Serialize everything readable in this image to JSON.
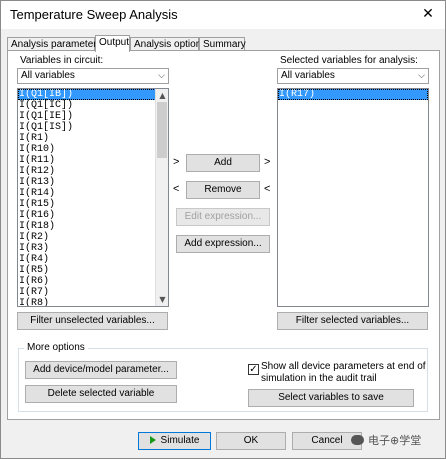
{
  "window": {
    "title": "Temperature Sweep Analysis",
    "close_glyph": "✕"
  },
  "tabs": [
    {
      "label": "Analysis parameters"
    },
    {
      "label": "Output"
    },
    {
      "label": "Analysis options"
    },
    {
      "label": "Summary"
    }
  ],
  "left": {
    "label": "Variables in circuit:",
    "combo_value": "All variables",
    "items": [
      "I(Q1[IB])",
      "I(Q1[IC])",
      "I(Q1[IE])",
      "I(Q1[IS])",
      "I(R1)",
      "I(R10)",
      "I(R11)",
      "I(R12)",
      "I(R13)",
      "I(R14)",
      "I(R15)",
      "I(R16)",
      "I(R18)",
      "I(R2)",
      "I(R3)",
      "I(R4)",
      "I(R5)",
      "I(R6)",
      "I(R7)",
      "I(R8)"
    ],
    "selected_index": 0,
    "filter_button": "Filter unselected variables..."
  },
  "right": {
    "label": "Selected variables for analysis:",
    "combo_value": "All variables",
    "items": [
      "I(R17)"
    ],
    "filter_button": "Filter selected variables..."
  },
  "middle": {
    "add": "Add",
    "remove": "Remove",
    "edit_expression": "Edit expression...",
    "add_expression": "Add expression...",
    "add_left_glyph": ">",
    "add_right_glyph": ">",
    "remove_left_glyph": "<",
    "remove_right_glyph": "<"
  },
  "more_options": {
    "title": "More options",
    "add_param": "Add device/model parameter...",
    "delete_var": "Delete selected variable",
    "show_all_line1": "Show all device parameters at end of",
    "show_all_line2": "simulation in the audit trail",
    "show_all_checked": true,
    "select_vars": "Select variables to save"
  },
  "footer": {
    "simulate": "Simulate",
    "ok": "OK",
    "cancel": "Cancel"
  },
  "watermark": {
    "text": "电子⊕学堂"
  }
}
